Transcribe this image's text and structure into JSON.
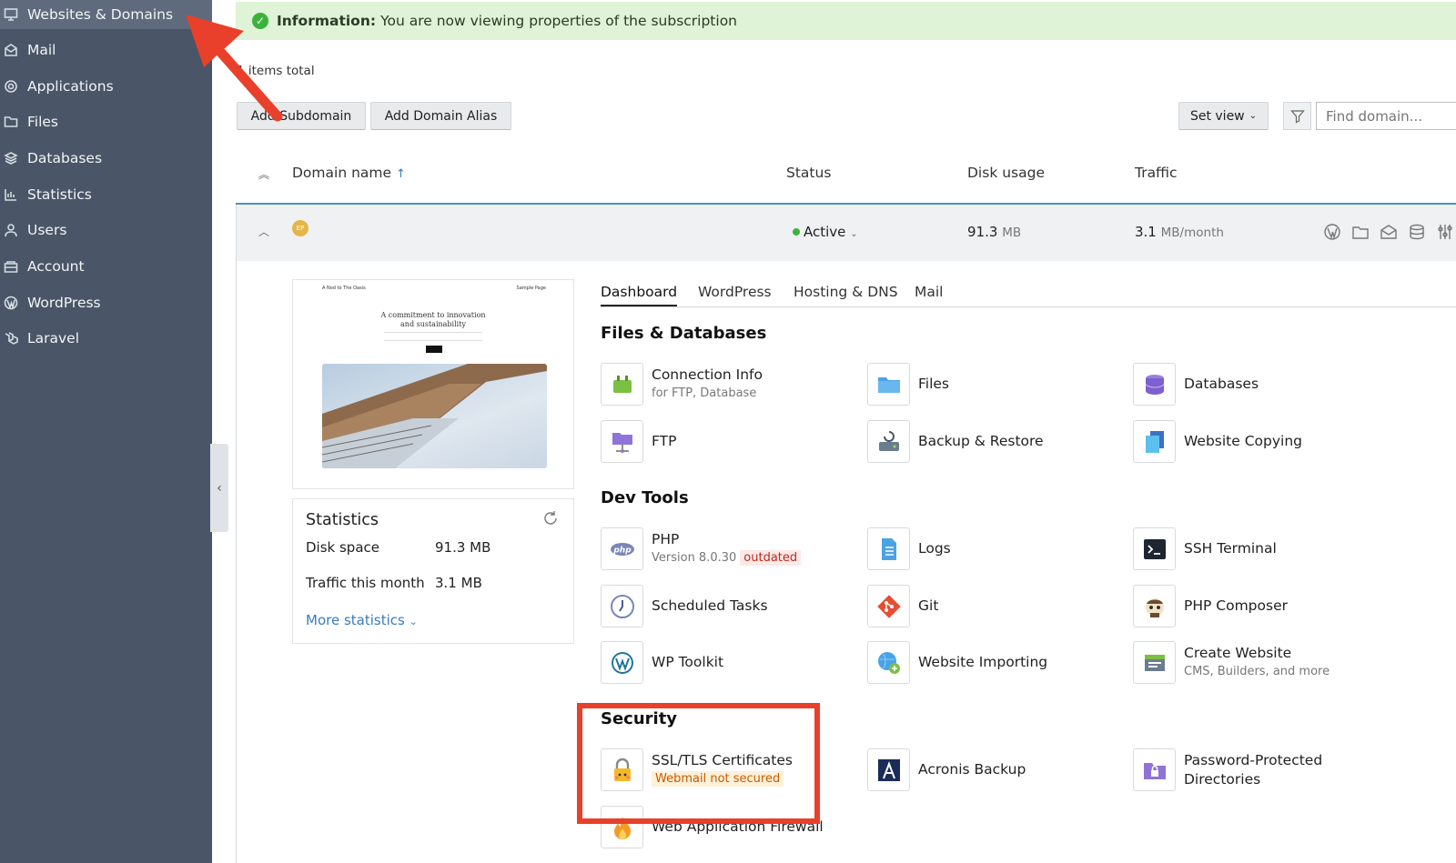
{
  "sidebar": {
    "items": [
      {
        "label": "Websites & Domains",
        "icon": "monitor-icon"
      },
      {
        "label": "Mail",
        "icon": "mail-icon"
      },
      {
        "label": "Applications",
        "icon": "gear-icon"
      },
      {
        "label": "Files",
        "icon": "folder-icon"
      },
      {
        "label": "Databases",
        "icon": "database-icon"
      },
      {
        "label": "Statistics",
        "icon": "bar-chart-icon"
      },
      {
        "label": "Users",
        "icon": "user-icon"
      },
      {
        "label": "Account",
        "icon": "account-icon"
      },
      {
        "label": "WordPress",
        "icon": "wordpress-icon"
      },
      {
        "label": "Laravel",
        "icon": "laravel-icon"
      }
    ]
  },
  "info": {
    "bold": "Information:",
    "text": "You are now viewing properties of the subscription"
  },
  "items_total": "1 items total",
  "toolbar": {
    "add_subdomain": "Add Subdomain",
    "add_domain_alias": "Add Domain Alias",
    "set_view": "Set view",
    "search_placeholder": "Find domain..."
  },
  "table": {
    "headers": {
      "domain": "Domain name",
      "status": "Status",
      "disk": "Disk usage",
      "traffic": "Traffic"
    },
    "row": {
      "avatar": "EP",
      "status": "Active",
      "disk_value": "91.3",
      "disk_unit": "MB",
      "traffic_value": "3.1",
      "traffic_unit": "MB/month"
    }
  },
  "preview": {
    "nav_left": "A Nod to The Oasis",
    "nav_right": "Sample Page",
    "title_line1": "A commitment to innovation",
    "title_line2": "and sustainability"
  },
  "statistics": {
    "title": "Statistics",
    "disk_label": "Disk space",
    "disk_value": "91.3 MB",
    "traffic_label": "Traffic this month",
    "traffic_value": "3.1 MB",
    "more": "More statistics"
  },
  "tabs": [
    "Dashboard",
    "WordPress",
    "Hosting & DNS",
    "Mail"
  ],
  "sections": {
    "files_db": {
      "title": "Files & Databases",
      "tools": [
        {
          "name": "Connection Info",
          "sub": "for FTP, Database"
        },
        {
          "name": "Files"
        },
        {
          "name": "Databases"
        },
        {
          "name": "FTP"
        },
        {
          "name": "Backup & Restore"
        },
        {
          "name": "Website Copying"
        }
      ]
    },
    "dev": {
      "title": "Dev Tools",
      "tools": [
        {
          "name": "PHP",
          "sub": "Version 8.0.30",
          "badge": "outdated"
        },
        {
          "name": "Logs"
        },
        {
          "name": "SSH Terminal"
        },
        {
          "name": "Scheduled Tasks"
        },
        {
          "name": "Git"
        },
        {
          "name": "PHP Composer"
        },
        {
          "name": "WP Toolkit"
        },
        {
          "name": "Website Importing"
        },
        {
          "name": "Create Website",
          "sub": "CMS, Builders, and more"
        }
      ]
    },
    "security": {
      "title": "Security",
      "tools": [
        {
          "name": "SSL/TLS Certificates",
          "badge": "Webmail not secured"
        },
        {
          "name": "Acronis Backup"
        },
        {
          "name": "Password-Protected",
          "name2": "Directories"
        },
        {
          "name": "Web Application Firewall"
        }
      ]
    }
  },
  "colors": {
    "sidebar": "#4a5667",
    "accent": "#3a7bb8",
    "annotation": "#e8402a",
    "success": "#3bb33b"
  }
}
